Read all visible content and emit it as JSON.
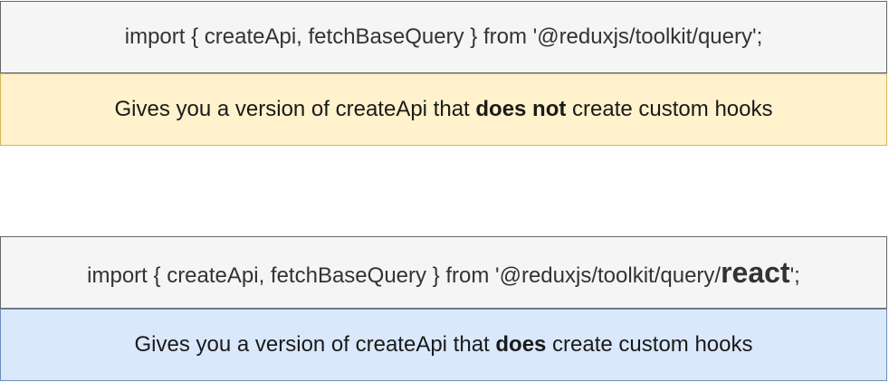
{
  "non_react_group": {
    "import_statement": "import { createApi, fetchBaseQuery } from '@reduxjs/toolkit/query';",
    "description": {
      "before": "Gives you a version of createApi that ",
      "emphasis": "does not",
      "after": " create custom hooks"
    },
    "colors": {
      "code_fill": "#f5f5f5",
      "code_stroke": "#666666",
      "description_fill": "#fff2cc",
      "description_stroke": "#d6b656"
    }
  },
  "react_group": {
    "import_statement": {
      "before": "import { createApi, fetchBaseQuery } from '@reduxjs/toolkit/query/",
      "emphasis": "react",
      "after": "';"
    },
    "description": {
      "before": "Gives you a version of createApi that ",
      "emphasis": "does",
      "after": " create custom hooks"
    },
    "colors": {
      "code_fill": "#f5f5f5",
      "code_stroke": "#666666",
      "description_fill": "#dae8fc",
      "description_stroke": "#6c8ebf"
    }
  }
}
